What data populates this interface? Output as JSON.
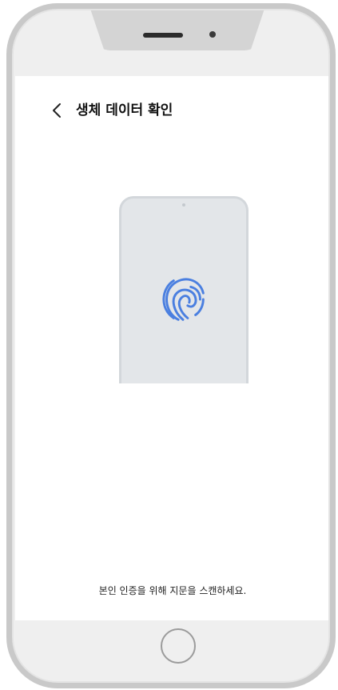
{
  "screen": {
    "title": "생체 데이터 확인",
    "instruction": "본인 인증을 위해 지문을 스캔하세요."
  },
  "icons": {
    "back": "chevron-left-icon",
    "fingerprint": "fingerprint-icon"
  },
  "colors": {
    "fingerprint_accent": "#4a7fe0",
    "illustration_bg": "#e3e6e9",
    "device_frame": "#c9c9c9"
  }
}
